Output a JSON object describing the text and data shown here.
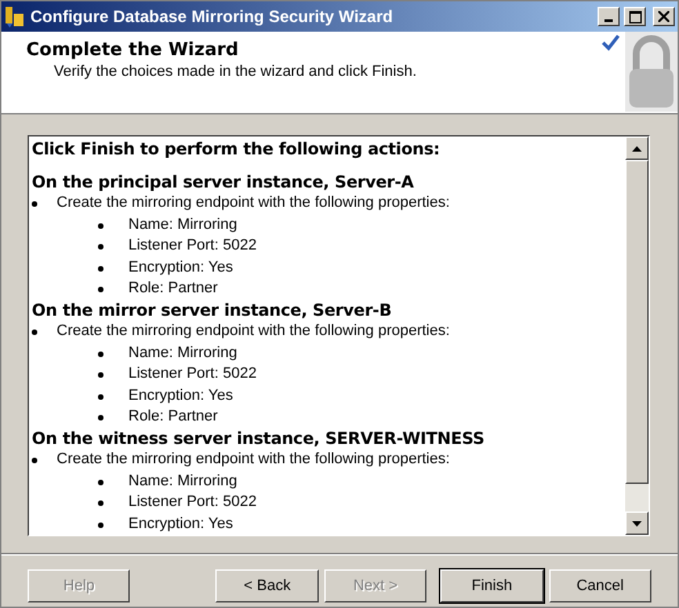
{
  "window": {
    "title": "Configure Database Mirroring Security Wizard"
  },
  "header": {
    "title": "Complete the Wizard",
    "subtitle": "Verify the choices made in the wizard and click Finish."
  },
  "summary": {
    "intro": "Click Finish to perform the following actions:",
    "sections": [
      {
        "heading": "On the principal server instance, Server-A",
        "action": "Create the mirroring endpoint with the following properties:",
        "properties": [
          "Name: Mirroring",
          "Listener Port: 5022",
          "Encryption: Yes",
          "Role: Partner"
        ]
      },
      {
        "heading": "On the mirror server instance, Server-B",
        "action": "Create the mirroring endpoint with the following properties:",
        "properties": [
          "Name: Mirroring",
          "Listener Port: 5022",
          "Encryption: Yes",
          "Role: Partner"
        ]
      },
      {
        "heading": "On the witness server instance, SERVER-WITNESS",
        "action": "Create the mirroring endpoint with the following properties:",
        "properties": [
          "Name: Mirroring",
          "Listener Port: 5022",
          "Encryption: Yes"
        ]
      }
    ]
  },
  "buttons": [
    {
      "label": "Help",
      "disabled": true,
      "default": false
    },
    {
      "label": "< Back",
      "disabled": false,
      "default": false
    },
    {
      "label": "Next >",
      "disabled": true,
      "default": false
    },
    {
      "label": "Finish",
      "disabled": false,
      "default": true
    },
    {
      "label": "Cancel",
      "disabled": false,
      "default": false
    }
  ]
}
